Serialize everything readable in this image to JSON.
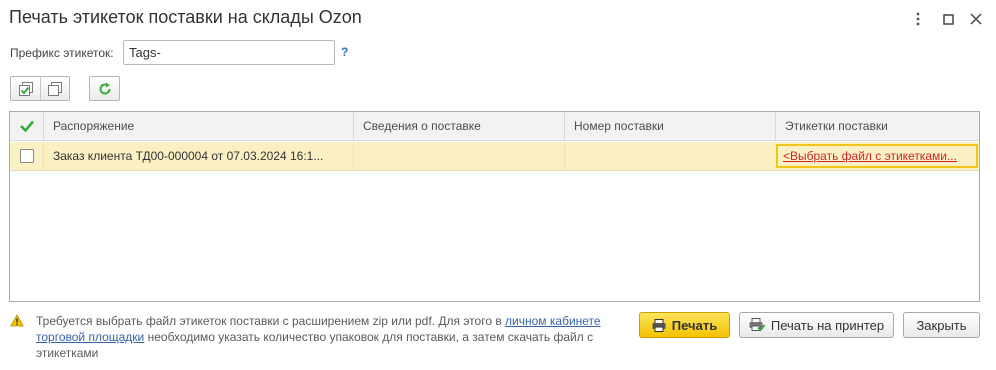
{
  "window": {
    "title": "Печать этикеток поставки на склады Ozon"
  },
  "form": {
    "prefix_label": "Префикс этикеток:",
    "prefix_value": "Tags-",
    "help": "?"
  },
  "toolbar": {
    "buttons": [
      "check-all",
      "uncheck-all",
      "refresh"
    ]
  },
  "table": {
    "headers": [
      "Распоряжение",
      "Сведения о поставке",
      "Номер поставки",
      "Этикетки поставки"
    ],
    "rows": [
      {
        "checked": false,
        "order": "Заказ клиента ТД00-000004 от 07.03.2024 16:1...",
        "supply_info": "",
        "supply_number": "",
        "labels_file": "<Выбрать файл с этикетками..."
      }
    ]
  },
  "warning": {
    "text_before": "Требуется выбрать файл этикеток поставки с расширением zip или pdf. Для этого в ",
    "link": "личном кабинете торговой площадки",
    "text_after": " необходимо указать количество упаковок для поставки, а затем скачать файл с этикетками"
  },
  "buttons": {
    "print": "Печать",
    "print_to_printer": "Печать на принтер",
    "close": "Закрыть"
  },
  "colors": {
    "row_highlight": "#fbf0c4",
    "accent_yellow": "#f2c300",
    "link_red": "#d0262b",
    "link_blue": "#3564a8",
    "check_green": "#39a93b"
  }
}
